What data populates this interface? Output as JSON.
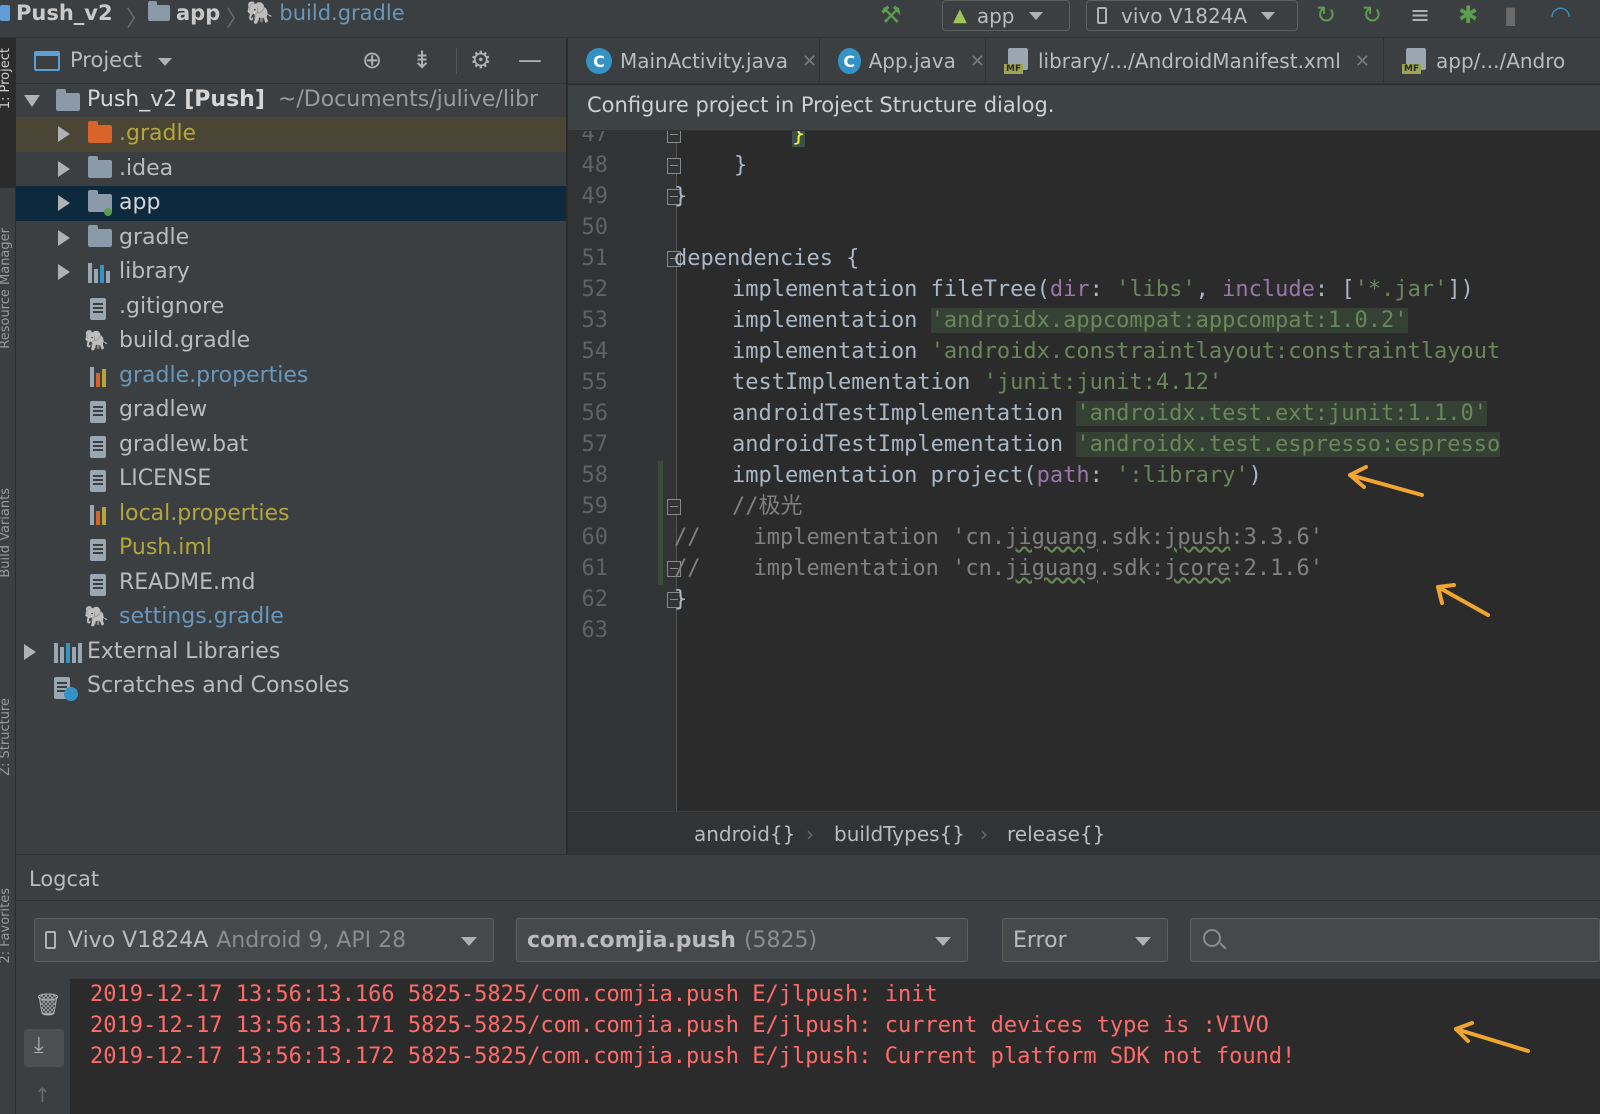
{
  "nav": {
    "crumbs": [
      "Push_v2",
      "app",
      "build.gradle"
    ],
    "run_config": "app",
    "device": "vivo V1824A"
  },
  "side_tabs": [
    "1: Project",
    "Resource Manager",
    "Build Variants",
    "Z: Structure",
    "2: Favorites"
  ],
  "project_panel": {
    "title": "Project",
    "root_name": "Push_v2",
    "root_module": "[Push]",
    "root_path": "~/Documents/julive/libr",
    "items": [
      {
        "label": ".gradle",
        "color": "#b5a63a",
        "icon": "folder-icon"
      },
      {
        "label": ".idea",
        "color": "#bbbbbb",
        "icon": "folder-icon"
      },
      {
        "label": "app",
        "color": "#bbbbbb",
        "icon": "module-folder-icon"
      },
      {
        "label": "gradle",
        "color": "#bbbbbb",
        "icon": "folder-icon"
      },
      {
        "label": "library",
        "color": "#bbbbbb",
        "icon": "library-folder-icon"
      },
      {
        "label": ".gitignore",
        "color": "#bbbbbb",
        "icon": "file-icon"
      },
      {
        "label": "build.gradle",
        "color": "#bbbbbb",
        "icon": "gradle-icon"
      },
      {
        "label": "gradle.properties",
        "color": "#6897bb",
        "icon": "properties-icon"
      },
      {
        "label": "gradlew",
        "color": "#bbbbbb",
        "icon": "file-icon"
      },
      {
        "label": "gradlew.bat",
        "color": "#bbbbbb",
        "icon": "file-icon"
      },
      {
        "label": "LICENSE",
        "color": "#bbbbbb",
        "icon": "file-icon"
      },
      {
        "label": "local.properties",
        "color": "#b5a63a",
        "icon": "properties-icon"
      },
      {
        "label": "Push.iml",
        "color": "#b5a63a",
        "icon": "iml-file-icon"
      },
      {
        "label": "README.md",
        "color": "#bbbbbb",
        "icon": "markdown-icon"
      },
      {
        "label": "settings.gradle",
        "color": "#6897bb",
        "icon": "gradle-icon"
      }
    ],
    "external_libraries": "External Libraries",
    "scratches": "Scratches and Consoles"
  },
  "editor_tabs": [
    {
      "label": "MainActivity.java",
      "icon": "class-icon"
    },
    {
      "label": "App.java",
      "icon": "class-icon"
    },
    {
      "label": "library/.../AndroidManifest.xml",
      "icon": "manifest-icon"
    },
    {
      "label": "app/.../Andro",
      "icon": "manifest-icon"
    }
  ],
  "notice": "Configure project in Project Structure dialog.",
  "code": {
    "line_numbers": [
      "47",
      "48",
      "49",
      "50",
      "51",
      "52",
      "53",
      "54",
      "55",
      "56",
      "57",
      "58",
      "59",
      "60",
      "61",
      "62",
      "63"
    ],
    "l47": "}",
    "l48": "}",
    "l49": "}",
    "l51": "dependencies {",
    "l52_a": "implementation fileTree(",
    "l52_b": "dir",
    "l52_c": ": ",
    "l52_d": "'libs'",
    "l52_e": ", ",
    "l52_f": "include",
    "l52_g": ": [",
    "l52_h": "'*.jar'",
    "l52_i": "])",
    "l53_a": "implementation ",
    "l53_b": "'androidx.appcompat:appcompat:1.0.2'",
    "l54_a": "implementation ",
    "l54_b": "'androidx.constraintlayout:constraintlayout",
    "l55_a": "testImplementation ",
    "l55_b": "'junit:junit:4.12'",
    "l56_a": "androidTestImplementation ",
    "l56_b": "'androidx.test.ext:junit:1.1.0'",
    "l57_a": "androidTestImplementation ",
    "l57_b": "'androidx.test.espresso:espresso",
    "l58_a": "implementation project(",
    "l58_b": "path",
    "l58_c": ": ",
    "l58_d": "':library'",
    "l58_e": ")",
    "l59": "//极光",
    "l60_a": "//    implementation 'cn.",
    "l60_b": "jiguang",
    "l60_c": ".sdk:",
    "l60_d": "jpush",
    "l60_e": ":3.3.6'",
    "l61_a": "//    implementation 'cn.",
    "l61_b": "jiguang",
    "l61_c": ".sdk:",
    "l61_d": "jcore",
    "l61_e": ":2.1.6'",
    "l62": "}"
  },
  "breadcrumbs": [
    "android{}",
    "buildTypes{}",
    "release{}"
  ],
  "logcat": {
    "title": "Logcat",
    "device": "Vivo V1824A",
    "device_info": "Android 9, API 28",
    "process": "com.comjia.push",
    "pid": "(5825)",
    "level": "Error",
    "lines": [
      "2019-12-17 13:56:13.166 5825-5825/com.comjia.push E/jlpush: init",
      "2019-12-17 13:56:13.171 5825-5825/com.comjia.push E/jlpush: current devices type is :VIVO",
      "2019-12-17 13:56:13.172 5825-5825/com.comjia.push E/jlpush: Current platform SDK not found!"
    ]
  },
  "colors": {
    "accent_annotation": "#f0a530",
    "error_text": "#ff6b68",
    "string": "#6a8759",
    "selection": "#0d293e"
  }
}
